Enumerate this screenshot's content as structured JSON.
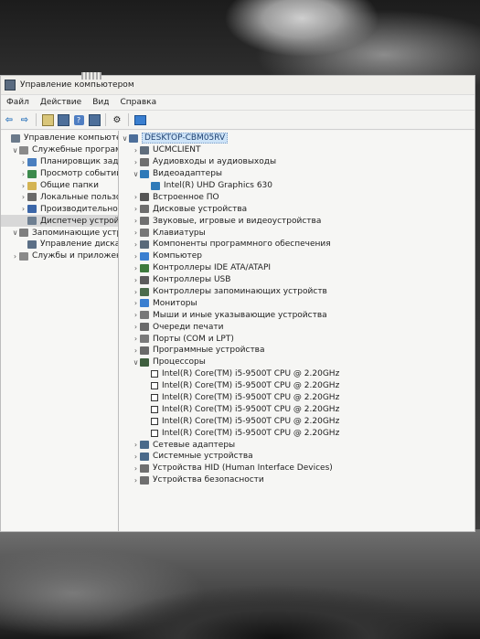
{
  "window": {
    "title": "Управление компьютером"
  },
  "menu": [
    "Файл",
    "Действие",
    "Вид",
    "Справка"
  ],
  "toolbar_icons": [
    "back-arrow-icon",
    "forward-arrow-icon",
    "folder-icon",
    "grid-icon",
    "help-icon",
    "grid-icon",
    "props-icon",
    "monitor-icon"
  ],
  "left_tree": [
    {
      "label": "Управление компьютером (л",
      "level": 0,
      "chev": "",
      "icon": "computer-icon",
      "color": "#6b7a8a"
    },
    {
      "label": "Служебные программы",
      "level": 1,
      "chev": "v",
      "icon": "tools-icon",
      "color": "#8a8a8a"
    },
    {
      "label": "Планировщик задач",
      "level": 2,
      "chev": ">",
      "icon": "scheduler-icon",
      "color": "#4a7fbf"
    },
    {
      "label": "Просмотр событий",
      "level": 2,
      "chev": ">",
      "icon": "events-icon",
      "color": "#3c8a4c"
    },
    {
      "label": "Общие папки",
      "level": 2,
      "chev": ">",
      "icon": "folder-icon",
      "color": "#d4b453"
    },
    {
      "label": "Локальные пользовате",
      "level": 2,
      "chev": ">",
      "icon": "users-icon",
      "color": "#6a6a6a"
    },
    {
      "label": "Производительность",
      "level": 2,
      "chev": ">",
      "icon": "perf-icon",
      "color": "#3b66a8"
    },
    {
      "label": "Диспетчер устройств",
      "level": 2,
      "chev": "",
      "icon": "device-manager-icon",
      "color": "#6e7f91",
      "selected": true
    },
    {
      "label": "Запоминающие устройст",
      "level": 1,
      "chev": "v",
      "icon": "storage-icon",
      "color": "#7f7f7f"
    },
    {
      "label": "Управление дисками",
      "level": 2,
      "chev": "",
      "icon": "disk-icon",
      "color": "#5b6f86"
    },
    {
      "label": "Службы и приложения",
      "level": 1,
      "chev": ">",
      "icon": "services-icon",
      "color": "#8a8a8a"
    }
  ],
  "device_tree": [
    {
      "label": "DESKTOP-CBM05RV",
      "level": 0,
      "chev": "v",
      "icon": "computer-icon",
      "color": "#4d6f9a",
      "root": true
    },
    {
      "label": "UCMCLIENT",
      "level": 1,
      "chev": ">",
      "icon": "generic-device-icon",
      "color": "#5f6d7c"
    },
    {
      "label": "Аудиовходы и аудиовыходы",
      "level": 1,
      "chev": ">",
      "icon": "audio-icon",
      "color": "#6f6f6f"
    },
    {
      "label": "Видеоадаптеры",
      "level": 1,
      "chev": "v",
      "icon": "display-adapter-icon",
      "color": "#2f7ab8"
    },
    {
      "label": "Intel(R) UHD Graphics 630",
      "level": 2,
      "chev": "",
      "icon": "display-adapter-icon",
      "color": "#2f7ab8"
    },
    {
      "label": "Встроенное ПО",
      "level": 1,
      "chev": ">",
      "icon": "firmware-icon",
      "color": "#555555"
    },
    {
      "label": "Дисковые устройства",
      "level": 1,
      "chev": ">",
      "icon": "disk-icon",
      "color": "#6d6d6d"
    },
    {
      "label": "Звуковые, игровые и видеоустройства",
      "level": 1,
      "chev": ">",
      "icon": "sound-icon",
      "color": "#6f6f6f"
    },
    {
      "label": "Клавиатуры",
      "level": 1,
      "chev": ">",
      "icon": "keyboard-icon",
      "color": "#777777"
    },
    {
      "label": "Компоненты программного обеспечения",
      "level": 1,
      "chev": ">",
      "icon": "software-icon",
      "color": "#5a6a7a"
    },
    {
      "label": "Компьютер",
      "level": 1,
      "chev": ">",
      "icon": "computer-icon",
      "color": "#3a7fd0"
    },
    {
      "label": "Контроллеры IDE ATA/ATAPI",
      "level": 1,
      "chev": ">",
      "icon": "ide-icon",
      "color": "#3d7a3d"
    },
    {
      "label": "Контроллеры USB",
      "level": 1,
      "chev": ">",
      "icon": "usb-icon",
      "color": "#5b5b5b"
    },
    {
      "label": "Контроллеры запоминающих устройств",
      "level": 1,
      "chev": ">",
      "icon": "storage-controller-icon",
      "color": "#4b6b4b"
    },
    {
      "label": "Мониторы",
      "level": 1,
      "chev": ">",
      "icon": "monitor-icon",
      "color": "#3a7fd0"
    },
    {
      "label": "Мыши и иные указывающие устройства",
      "level": 1,
      "chev": ">",
      "icon": "mouse-icon",
      "color": "#777777"
    },
    {
      "label": "Очереди печати",
      "level": 1,
      "chev": ">",
      "icon": "printer-icon",
      "color": "#6a6a6a"
    },
    {
      "label": "Порты (COM и LPT)",
      "level": 1,
      "chev": ">",
      "icon": "port-icon",
      "color": "#7a7a7a"
    },
    {
      "label": "Программные устройства",
      "level": 1,
      "chev": ">",
      "icon": "software-device-icon",
      "color": "#6a6a6a"
    },
    {
      "label": "Процессоры",
      "level": 1,
      "chev": "v",
      "icon": "processor-icon",
      "color": "#3f5f3f"
    },
    {
      "label": "Intel(R) Core(TM) i5-9500T CPU @ 2.20GHz",
      "level": 2,
      "chev": "",
      "icon": "processor-icon",
      "cpu": true
    },
    {
      "label": "Intel(R) Core(TM) i5-9500T CPU @ 2.20GHz",
      "level": 2,
      "chev": "",
      "icon": "processor-icon",
      "cpu": true
    },
    {
      "label": "Intel(R) Core(TM) i5-9500T CPU @ 2.20GHz",
      "level": 2,
      "chev": "",
      "icon": "processor-icon",
      "cpu": true
    },
    {
      "label": "Intel(R) Core(TM) i5-9500T CPU @ 2.20GHz",
      "level": 2,
      "chev": "",
      "icon": "processor-icon",
      "cpu": true
    },
    {
      "label": "Intel(R) Core(TM) i5-9500T CPU @ 2.20GHz",
      "level": 2,
      "chev": "",
      "icon": "processor-icon",
      "cpu": true
    },
    {
      "label": "Intel(R) Core(TM) i5-9500T CPU @ 2.20GHz",
      "level": 2,
      "chev": "",
      "icon": "processor-icon",
      "cpu": true
    },
    {
      "label": "Сетевые адаптеры",
      "level": 1,
      "chev": ">",
      "icon": "network-adapter-icon",
      "color": "#4a6a8a"
    },
    {
      "label": "Системные устройства",
      "level": 1,
      "chev": ">",
      "icon": "system-device-icon",
      "color": "#4a6a8a"
    },
    {
      "label": "Устройства HID (Human Interface Devices)",
      "level": 1,
      "chev": ">",
      "icon": "hid-icon",
      "color": "#6f6f6f"
    },
    {
      "label": "Устройства безопасности",
      "level": 1,
      "chev": ">",
      "icon": "security-device-icon",
      "color": "#6f6f6f"
    }
  ]
}
